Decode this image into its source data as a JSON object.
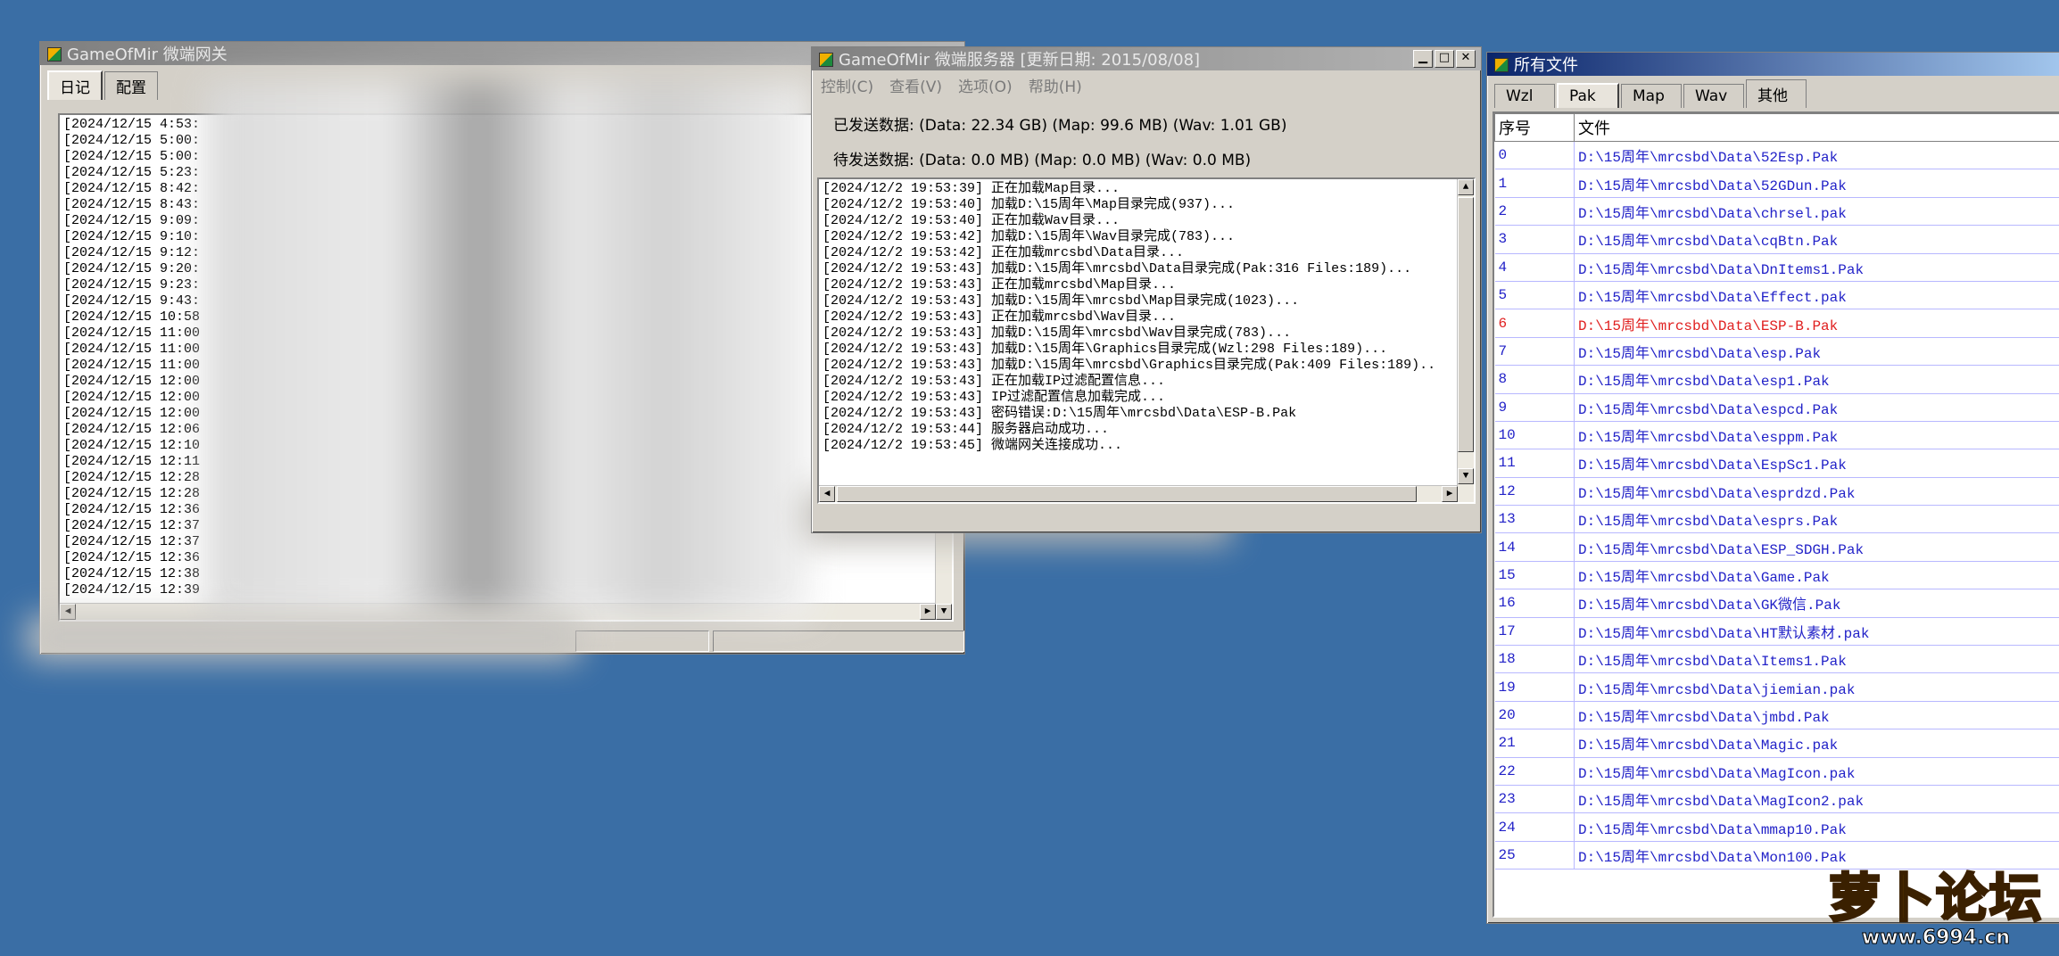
{
  "win1": {
    "title": "GameOfMir 微端网关",
    "tabs": [
      "日记",
      "配置"
    ],
    "log": [
      "[2024/12/15 4:53:",
      "[2024/12/15 5:00:",
      "[2024/12/15 5:00:",
      "[2024/12/15 5:23:",
      "[2024/12/15 8:42:",
      "[2024/12/15 8:43:",
      "[2024/12/15 9:09:",
      "[2024/12/15 9:10:",
      "[2024/12/15 9:12:",
      "[2024/12/15 9:20:",
      "[2024/12/15 9:23:",
      "[2024/12/15 9:43:",
      "[2024/12/15 10:58",
      "[2024/12/15 11:00",
      "[2024/12/15 11:00",
      "[2024/12/15 11:00",
      "[2024/12/15 12:00",
      "[2024/12/15 12:00",
      "[2024/12/15 12:00",
      "[2024/12/15 12:06",
      "[2024/12/15 12:10",
      "[2024/12/15 12:11",
      "[2024/12/15 12:28",
      "[2024/12/15 12:28",
      "[2024/12/15 12:36",
      "[2024/12/15 12:37",
      "[2024/12/15 12:37",
      "[2024/12/15 12:36",
      "[2024/12/15 12:38",
      "[2024/12/15 12:39"
    ]
  },
  "win2": {
    "title": "GameOfMir 微端服务器 [更新日期: 2015/08/08]",
    "menu": [
      "控制(C)",
      "查看(V)",
      "选项(O)",
      "帮助(H)"
    ],
    "sent": "已发送数据: (Data: 22.34 GB) (Map: 99.6 MB) (Wav: 1.01 GB)",
    "pending": "待发送数据: (Data: 0.0 MB) (Map: 0.0 MB) (Wav: 0.0 MB)",
    "log": [
      "[2024/12/2 19:53:39] 正在加载Map目录...",
      "[2024/12/2 19:53:40] 加载D:\\15周年\\Map目录完成(937)...",
      "[2024/12/2 19:53:40] 正在加载Wav目录...",
      "[2024/12/2 19:53:42] 加载D:\\15周年\\Wav目录完成(783)...",
      "[2024/12/2 19:53:42] 正在加载mrcsbd\\Data目录...",
      "[2024/12/2 19:53:43] 加载D:\\15周年\\mrcsbd\\Data目录完成(Pak:316 Files:189)...",
      "[2024/12/2 19:53:43] 正在加载mrcsbd\\Map目录...",
      "[2024/12/2 19:53:43] 加载D:\\15周年\\mrcsbd\\Map目录完成(1023)...",
      "[2024/12/2 19:53:43] 正在加载mrcsbd\\Wav目录...",
      "[2024/12/2 19:53:43] 加载D:\\15周年\\mrcsbd\\Wav目录完成(783)...",
      "[2024/12/2 19:53:43] 加载D:\\15周年\\Graphics目录完成(Wzl:298 Files:189)...",
      "[2024/12/2 19:53:43] 加载D:\\15周年\\mrcsbd\\Graphics目录完成(Pak:409 Files:189)..",
      "[2024/12/2 19:53:43] 正在加载IP过滤配置信息...",
      "[2024/12/2 19:53:43] IP过滤配置信息加载完成...",
      "[2024/12/2 19:53:43] 密码错误:D:\\15周年\\mrcsbd\\Data\\ESP-B.Pak",
      "[2024/12/2 19:53:44] 服务器启动成功...",
      "[2024/12/2 19:53:45] 微端网关连接成功..."
    ]
  },
  "win3": {
    "title": "所有文件",
    "tabs": [
      "Wzl",
      "Pak",
      "Map",
      "Wav",
      "其他"
    ],
    "col_index": "序号",
    "col_file": "文件",
    "rows": [
      {
        "i": "0",
        "f": "D:\\15周年\\mrcsbd\\Data\\52Esp.Pak"
      },
      {
        "i": "1",
        "f": "D:\\15周年\\mrcsbd\\Data\\52GDun.Pak"
      },
      {
        "i": "2",
        "f": "D:\\15周年\\mrcsbd\\Data\\chrsel.pak"
      },
      {
        "i": "3",
        "f": "D:\\15周年\\mrcsbd\\Data\\cqBtn.Pak"
      },
      {
        "i": "4",
        "f": "D:\\15周年\\mrcsbd\\Data\\DnItems1.Pak"
      },
      {
        "i": "5",
        "f": "D:\\15周年\\mrcsbd\\Data\\Effect.pak"
      },
      {
        "i": "6",
        "f": "D:\\15周年\\mrcsbd\\Data\\ESP-B.Pak"
      },
      {
        "i": "7",
        "f": "D:\\15周年\\mrcsbd\\Data\\esp.Pak"
      },
      {
        "i": "8",
        "f": "D:\\15周年\\mrcsbd\\Data\\esp1.Pak"
      },
      {
        "i": "9",
        "f": "D:\\15周年\\mrcsbd\\Data\\espcd.Pak"
      },
      {
        "i": "10",
        "f": "D:\\15周年\\mrcsbd\\Data\\esppm.Pak"
      },
      {
        "i": "11",
        "f": "D:\\15周年\\mrcsbd\\Data\\EspSc1.Pak"
      },
      {
        "i": "12",
        "f": "D:\\15周年\\mrcsbd\\Data\\esprdzd.Pak"
      },
      {
        "i": "13",
        "f": "D:\\15周年\\mrcsbd\\Data\\esprs.Pak"
      },
      {
        "i": "14",
        "f": "D:\\15周年\\mrcsbd\\Data\\ESP_SDGH.Pak"
      },
      {
        "i": "15",
        "f": "D:\\15周年\\mrcsbd\\Data\\Game.Pak"
      },
      {
        "i": "16",
        "f": "D:\\15周年\\mrcsbd\\Data\\GK微信.Pak"
      },
      {
        "i": "17",
        "f": "D:\\15周年\\mrcsbd\\Data\\HT默认素材.pak"
      },
      {
        "i": "18",
        "f": "D:\\15周年\\mrcsbd\\Data\\Items1.Pak"
      },
      {
        "i": "19",
        "f": "D:\\15周年\\mrcsbd\\Data\\jiemian.pak"
      },
      {
        "i": "20",
        "f": "D:\\15周年\\mrcsbd\\Data\\jmbd.Pak"
      },
      {
        "i": "21",
        "f": "D:\\15周年\\mrcsbd\\Data\\Magic.pak"
      },
      {
        "i": "22",
        "f": "D:\\15周年\\mrcsbd\\Data\\MagIcon.pak"
      },
      {
        "i": "23",
        "f": "D:\\15周年\\mrcsbd\\Data\\MagIcon2.pak"
      },
      {
        "i": "24",
        "f": "D:\\15周年\\mrcsbd\\Data\\mmap10.Pak"
      },
      {
        "i": "25",
        "f": "D:\\15周年\\mrcsbd\\Data\\Mon100.Pak"
      }
    ]
  },
  "watermark": {
    "brand": "萝卜论坛",
    "url": "www.6994.cn"
  },
  "colors": {
    "desktop": "#3a6ea5",
    "error_row": "#e02020",
    "file_text": "#2222c8"
  }
}
